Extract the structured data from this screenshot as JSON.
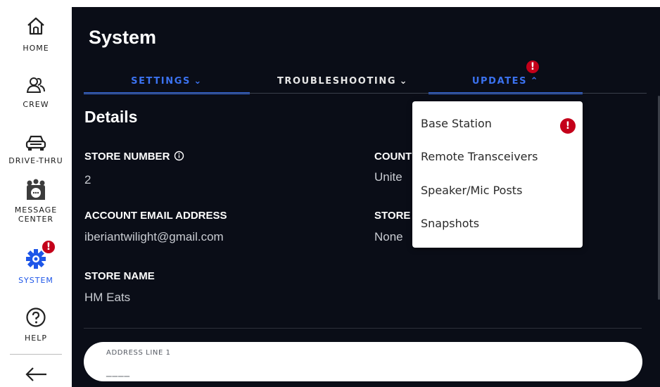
{
  "sidebar": {
    "items": [
      {
        "label": "HOME",
        "icon": "home-icon"
      },
      {
        "label": "CREW",
        "icon": "crew-icon"
      },
      {
        "label": "DRIVE-THRU",
        "icon": "car-icon"
      },
      {
        "label_line1": "MESSAGE",
        "label_line2": "CENTER",
        "icon": "message-center-icon"
      },
      {
        "label": "SYSTEM",
        "icon": "gear-icon",
        "badge": "!"
      },
      {
        "label": "HELP",
        "icon": "help-icon"
      }
    ],
    "back_icon": "arrow-left-icon"
  },
  "header": {
    "title": "System"
  },
  "tabs": [
    {
      "label": "SETTINGS",
      "chevron": "⌄"
    },
    {
      "label": "TROUBLESHOOTING",
      "chevron": "⌄"
    },
    {
      "label": "UPDATES",
      "chevron": "⌃",
      "badge": "!"
    }
  ],
  "details": {
    "title": "Details",
    "store_number": {
      "label": "STORE NUMBER",
      "value": "2"
    },
    "account_email": {
      "label": "ACCOUNT EMAIL ADDRESS",
      "value": "iberiantwilight@gmail.com"
    },
    "store_name": {
      "label": "STORE NAME",
      "value": "HM Eats"
    },
    "country": {
      "label": "COUNT",
      "value": "Unite"
    },
    "store_other": {
      "label": "STORE",
      "value": "None"
    }
  },
  "address": {
    "label": "ADDRESS LINE 1",
    "value": "____"
  },
  "updates_menu": {
    "items": [
      "Base Station",
      "Remote Transceivers",
      "Speaker/Mic Posts",
      "Snapshots"
    ],
    "badge": "!"
  },
  "colors": {
    "accent": "#2f66e5",
    "alert": "#c4001a",
    "panel_bg": "#0a0d17"
  }
}
